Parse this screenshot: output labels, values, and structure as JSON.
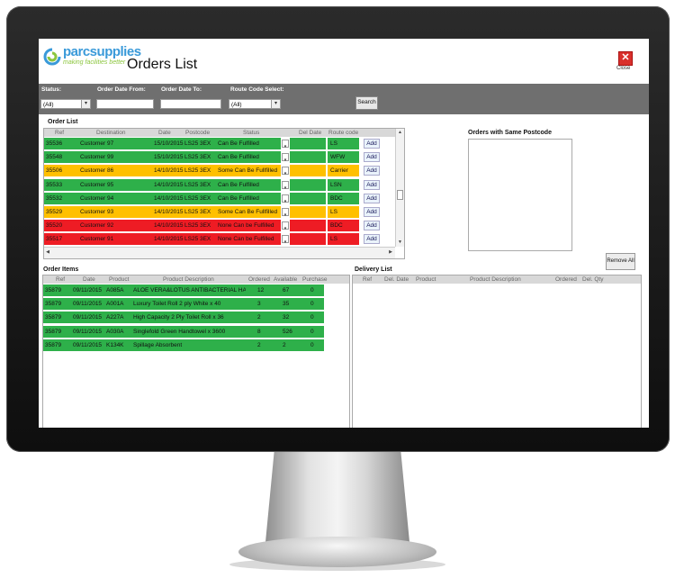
{
  "app": {
    "brand": "parcsupplies",
    "tagline": "making facilities better",
    "title": "Orders List",
    "close_label": "Close"
  },
  "colors": {
    "fulfilled": "#2eb04a",
    "partial": "#ffc000",
    "none": "#ee1c24",
    "toolbar": "#6f6f6f"
  },
  "filters": {
    "status_label": "Status:",
    "status_value": "(All)",
    "date_from_label": "Order Date From:",
    "date_from_value": "",
    "date_to_label": "Order Date To:",
    "date_to_value": "",
    "route_label": "Route Code Select:",
    "route_value": "(All)",
    "search_label": "Search"
  },
  "order_list": {
    "label": "Order List",
    "columns": [
      "Ref",
      "Destination",
      "Date",
      "Postcode",
      "Status",
      "Del Date",
      "Route code"
    ],
    "add_label": "Add",
    "rows": [
      {
        "ref": "35536",
        "dest": "Customer 97",
        "date": "15/10/2015",
        "postcode": "LS25 3EX",
        "status": "Can Be Fulfilled",
        "route": "LS",
        "level": "fulfilled"
      },
      {
        "ref": "35548",
        "dest": "Customer 99",
        "date": "15/10/2015",
        "postcode": "LS25 3EX",
        "status": "Can Be Fulfilled",
        "route": "WFW",
        "level": "fulfilled"
      },
      {
        "ref": "35506",
        "dest": "Customer 86",
        "date": "14/10/2015",
        "postcode": "LS25 3EX",
        "status": "Some Can Be Fullfilled",
        "route": "Carrier",
        "level": "partial"
      },
      {
        "ref": "35533",
        "dest": "Customer 95",
        "date": "14/10/2015",
        "postcode": "LS25 3EX",
        "status": "Can Be Fulfilled",
        "route": "LSN",
        "level": "fulfilled"
      },
      {
        "ref": "35532",
        "dest": "Customer 94",
        "date": "14/10/2015",
        "postcode": "LS25 3EX",
        "status": "Can Be Fulfilled",
        "route": "BDC",
        "level": "fulfilled"
      },
      {
        "ref": "35529",
        "dest": "Customer 93",
        "date": "14/10/2015",
        "postcode": "LS25 3EX",
        "status": "Some Can Be Fullfilled",
        "route": "LS",
        "level": "partial"
      },
      {
        "ref": "35520",
        "dest": "Customer 92",
        "date": "14/10/2015",
        "postcode": "LS25 3EX",
        "status": "None Can be Fulfilled",
        "route": "BDC",
        "level": "none"
      },
      {
        "ref": "35517",
        "dest": "Customer 91",
        "date": "14/10/2015",
        "postcode": "LS25 3EX",
        "status": "None Can be Fulfilled",
        "route": "LS",
        "level": "none"
      }
    ]
  },
  "same_postcode": {
    "label": "Orders with Same Postcode"
  },
  "remove_all_label": "Remove All",
  "order_items": {
    "label": "Order Items",
    "columns": [
      "Ref",
      "Date",
      "Product",
      "Product Description",
      "Ordered",
      "Available",
      "Purchase"
    ],
    "rows": [
      {
        "ref": "35879",
        "date": "09/11/2015",
        "product": "A085A",
        "desc": "ALOE VERA&LOTUS ANTIBACTERIAL HAND",
        "ordered": "12",
        "available": "67",
        "purchase": "0"
      },
      {
        "ref": "35879",
        "date": "09/11/2015",
        "product": "A001A",
        "desc": "Luxury Toilet Roll 2 ply White x 40",
        "ordered": "3",
        "available": "35",
        "purchase": "0"
      },
      {
        "ref": "35879",
        "date": "09/11/2015",
        "product": "A227A",
        "desc": "High Capacity 2 Ply Toilet Roll x 36",
        "ordered": "2",
        "available": "32",
        "purchase": "0"
      },
      {
        "ref": "35879",
        "date": "09/11/2015",
        "product": "A030A",
        "desc": "Singlefold Green Handtowel x 3600",
        "ordered": "8",
        "available": "526",
        "purchase": "0"
      },
      {
        "ref": "35879",
        "date": "09/11/2015",
        "product": "K134K",
        "desc": "Spillage Absorbent",
        "ordered": "2",
        "available": "2",
        "purchase": "0"
      }
    ]
  },
  "delivery_list": {
    "label": "Delivery List",
    "columns": [
      "Ref",
      "Del. Date",
      "Product",
      "Product Description",
      "Ordered",
      "Del. Qty"
    ]
  }
}
